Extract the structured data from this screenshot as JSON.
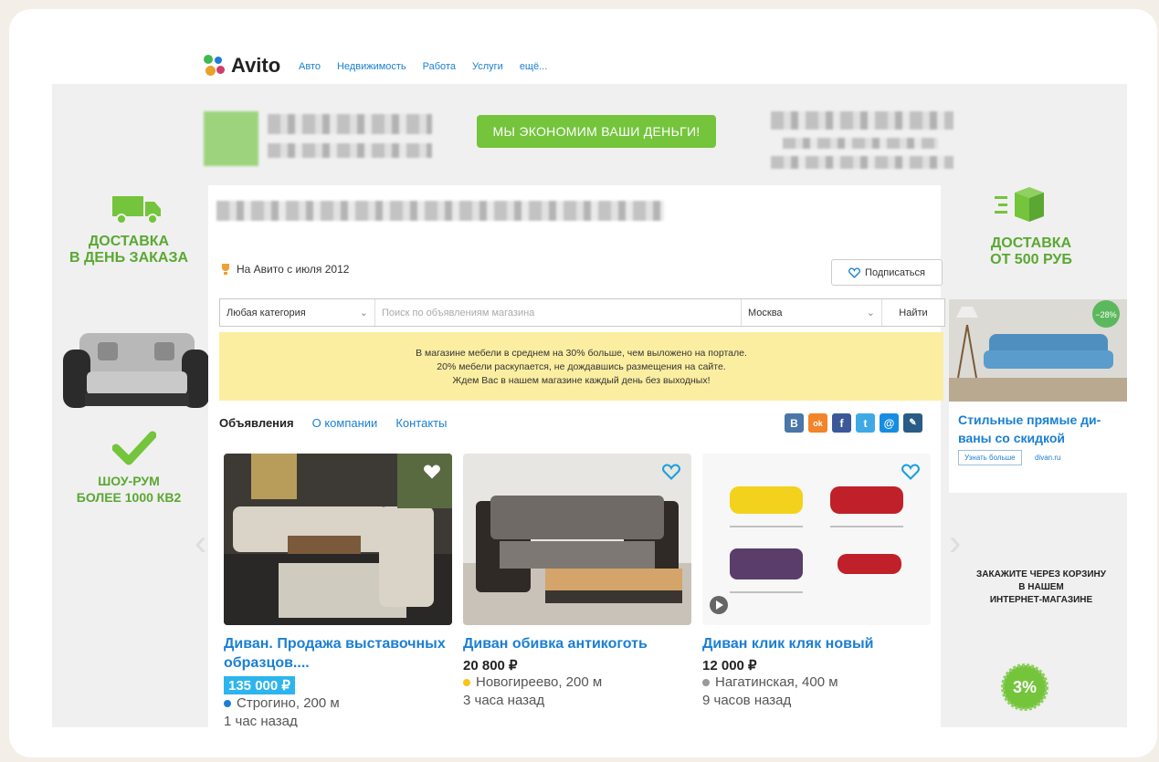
{
  "topbar": {
    "logo": "Avito",
    "nav": [
      "Авто",
      "Недвижимость",
      "Работа",
      "Услуги",
      "ещё..."
    ]
  },
  "header": {
    "slogan": "МЫ ЭКОНОМИМ ВАШИ ДЕНЬГИ!"
  },
  "left_promos": {
    "delivery_line1": "ДОСТАВКА",
    "delivery_line2": "В ДЕНЬ ЗАКАЗА",
    "showroom_line1": "ШОУ-РУМ",
    "showroom_line2": "БОЛЕЕ 1000 КВ2"
  },
  "right_promos": {
    "delivery_line1": "ДОСТАВКА",
    "delivery_line2": "ОТ 500 РУБ",
    "order_line1": "ЗАКАЖИТЕ ЧЕРЕЗ КОРЗИНУ",
    "order_line2": "В НАШЕМ",
    "order_line3": "ИНТЕРНЕТ-МАГАЗИНЕ",
    "badge": "3%"
  },
  "shop": {
    "since": "На Авито с июля 2012",
    "subscribe_label": "Подписаться"
  },
  "search": {
    "category": "Любая категория",
    "placeholder": "Поиск по объявлениям магазина",
    "city": "Москва",
    "find_label": "Найти"
  },
  "notice": {
    "line1": "В магазине мебели в среднем на 30% больше, чем выложено на портале.",
    "line2": "20% мебели раскупается, не дождавшись размещения на сайте.",
    "line3": "Ждем Вас в нашем магазине каждый день без выходных!"
  },
  "tabs": {
    "ads": "Объявления",
    "about": "О компании",
    "contacts": "Контакты"
  },
  "social": {
    "vk": "В",
    "ok": "ok",
    "fb": "f",
    "tw": "t",
    "mail": "@",
    "lj": "✎"
  },
  "listings": [
    {
      "title": "Диван. Продажа выставочных образцов....",
      "price": "135 000 ₽",
      "location": "Строгино, 200 м",
      "time": "1 час назад",
      "dot_color": "#1a7fd4"
    },
    {
      "title": "Диван обивка антикоготь",
      "price": "20 800 ₽",
      "location": "Новогиреево, 200 м",
      "time": "3 часа назад",
      "dot_color": "#f5c518"
    },
    {
      "title": "Диван клик кляк новый",
      "price": "12 000 ₽",
      "location": "Нагатинская, 400 м",
      "time": "9 часов назад",
      "dot_color": "#999999"
    }
  ],
  "ad": {
    "discount": "−28%",
    "title_line1": "Стильные прямые ди-",
    "title_line2": "ваны со  скидкой",
    "button": "Узнать больше",
    "domain": "divan.ru"
  },
  "colors": {
    "brand_green": "#74c43c",
    "link_blue": "#1a7fd4",
    "notice_yellow": "#fbeea1"
  }
}
